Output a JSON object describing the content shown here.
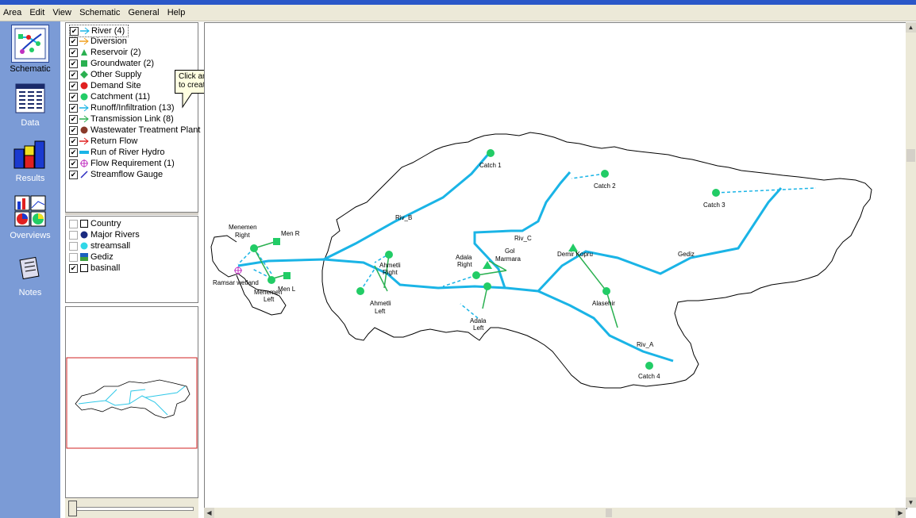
{
  "menu": [
    "Area",
    "Edit",
    "View",
    "Schematic",
    "General",
    "Help"
  ],
  "nav": [
    {
      "label": "Schematic",
      "icon": "schematic-icon",
      "active": true
    },
    {
      "label": "Data",
      "icon": "data-table-icon",
      "active": false
    },
    {
      "label": "Results",
      "icon": "bar-chart-icon",
      "active": false
    },
    {
      "label": "Overviews",
      "icon": "overview-icon",
      "active": false
    },
    {
      "label": "Notes",
      "icon": "notes-icon",
      "active": false
    }
  ],
  "legend": [
    {
      "label": "River (4)",
      "icon": "river-arrow-icon",
      "color": "#1ab4e6"
    },
    {
      "label": "Diversion",
      "icon": "diversion-arrow-icon",
      "color": "#f0a020"
    },
    {
      "label": "Reservoir (2)",
      "icon": "reservoir-triangle-icon",
      "color": "#2ab050"
    },
    {
      "label": "Groundwater (2)",
      "icon": "groundwater-square-icon",
      "color": "#2ab050"
    },
    {
      "label": "Other Supply",
      "icon": "other-supply-diamond-icon",
      "color": "#2ab050"
    },
    {
      "label": "Demand Site",
      "icon": "demand-site-circle-icon",
      "color": "#e02020"
    },
    {
      "label": "Catchment (11)",
      "icon": "catchment-circle-icon",
      "color": "#22cc66"
    },
    {
      "label": "Runoff/Infiltration (13)",
      "icon": "runoff-arrow-icon",
      "color": "#1ab4e6"
    },
    {
      "label": "Transmission Link (8)",
      "icon": "transmission-arrow-icon",
      "color": "#2ab050"
    },
    {
      "label": "Wastewater Treatment Plant",
      "icon": "wwtp-circle-icon",
      "color": "#8a3a2a"
    },
    {
      "label": "Return Flow",
      "icon": "return-flow-arrow-icon",
      "color": "#e02020"
    },
    {
      "label": "Run of River Hydro",
      "icon": "hydro-bar-icon",
      "color": "#1ab4e6"
    },
    {
      "label": "Flow Requirement (1)",
      "icon": "flow-requirement-icon",
      "color": "#c030c0"
    },
    {
      "label": "Streamflow Gauge",
      "icon": "gauge-icon",
      "color": "#2a2ac0"
    }
  ],
  "tooltip": "Click and drag onto diagram to create",
  "layers": [
    {
      "label": "Country",
      "checked": false,
      "icon": "country-layer-icon"
    },
    {
      "label": "Major Rivers",
      "checked": false,
      "icon": "major-rivers-icon"
    },
    {
      "label": "streamsall",
      "checked": false,
      "icon": "streams-icon"
    },
    {
      "label": "Gediz",
      "checked": false,
      "icon": "gediz-layer-icon"
    },
    {
      "label": "basinall",
      "checked": true,
      "icon": "basin-layer-icon"
    }
  ],
  "map_labels": {
    "catch1": "Catch 1",
    "catch2": "Catch 2",
    "catch3": "Catch 3",
    "catch4": "Catch 4",
    "riv_b": "Riv_B",
    "riv_c": "Riv_C",
    "riv_a": "Riv_A",
    "gediz": "Gediz",
    "menemen_right_1": "Menemen",
    "menemen_right_2": "Right",
    "men_r": "Men R",
    "men_l": "Men L",
    "menemen_left_1": "Menemen",
    "menemen_left_2": "Left",
    "ramsar": "Ramsar wetland",
    "ahmetli_right_1": "Ahmetli",
    "ahmetli_right_2": "Right",
    "ahmetli_left_1": "Ahmetli",
    "ahmetli_left_2": "Left",
    "adala_right_1": "Adala",
    "adala_right_2": "Right",
    "gol_1": "Gol",
    "gol_2": "Marmara",
    "adala_left_1": "Adala",
    "adala_left_2": "Left",
    "demirkopru": "Demir Kopru",
    "alasehir": "Alasehir"
  },
  "colors": {
    "river": "#1ab4e6",
    "catchment": "#22cc66",
    "transmission": "#2ab050"
  }
}
